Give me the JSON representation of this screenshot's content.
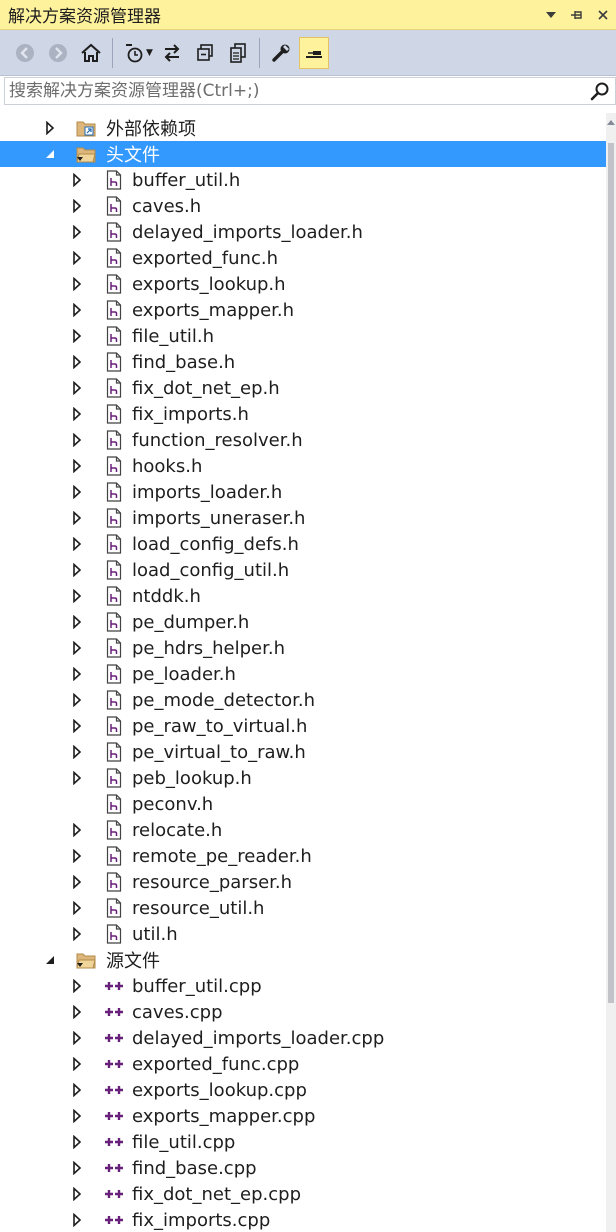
{
  "window": {
    "title": "解决方案资源管理器",
    "dropdown_icon": "chevron-down-icon",
    "pin_icon": "pin-icon",
    "close_icon": "close-icon"
  },
  "toolbar": {
    "items": [
      {
        "name": "back-button",
        "icon": "arrow-left-icon"
      },
      {
        "name": "forward-button",
        "icon": "arrow-right-icon"
      },
      {
        "name": "home-button",
        "icon": "home-icon"
      },
      {
        "name": "pending-changes-filter-button",
        "icon": "clock-filter-icon"
      },
      {
        "name": "sync-with-active-document-button",
        "icon": "sync-arrows-icon"
      },
      {
        "name": "collapse-all-button",
        "icon": "collapse-all-icon"
      },
      {
        "name": "show-all-files-button",
        "icon": "copy-files-icon"
      },
      {
        "name": "properties-button",
        "icon": "wrench-icon"
      },
      {
        "name": "preview-selected-items-button",
        "icon": "preview-icon"
      }
    ]
  },
  "search": {
    "placeholder": "搜索解决方案资源管理器(Ctrl+;)",
    "value": "",
    "icon": "search-icon"
  },
  "colors": {
    "title_bg": "#fff29d",
    "toolbar_bg": "#cfd6e5",
    "selection": "#3399ff",
    "cpp_icon": "#68217a"
  },
  "tree": {
    "external": {
      "label": "外部依赖项",
      "expanded": false
    },
    "headers": {
      "label": "头文件",
      "expanded": true,
      "selected": true,
      "files": [
        {
          "label": "buffer_util.h",
          "has_children": true
        },
        {
          "label": "caves.h",
          "has_children": true
        },
        {
          "label": "delayed_imports_loader.h",
          "has_children": true
        },
        {
          "label": "exported_func.h",
          "has_children": true
        },
        {
          "label": "exports_lookup.h",
          "has_children": true
        },
        {
          "label": "exports_mapper.h",
          "has_children": true
        },
        {
          "label": "file_util.h",
          "has_children": true
        },
        {
          "label": "find_base.h",
          "has_children": true
        },
        {
          "label": "fix_dot_net_ep.h",
          "has_children": true
        },
        {
          "label": "fix_imports.h",
          "has_children": true
        },
        {
          "label": "function_resolver.h",
          "has_children": true
        },
        {
          "label": "hooks.h",
          "has_children": true
        },
        {
          "label": "imports_loader.h",
          "has_children": true
        },
        {
          "label": "imports_uneraser.h",
          "has_children": true
        },
        {
          "label": "load_config_defs.h",
          "has_children": true
        },
        {
          "label": "load_config_util.h",
          "has_children": true
        },
        {
          "label": "ntddk.h",
          "has_children": true
        },
        {
          "label": "pe_dumper.h",
          "has_children": true
        },
        {
          "label": "pe_hdrs_helper.h",
          "has_children": true
        },
        {
          "label": "pe_loader.h",
          "has_children": true
        },
        {
          "label": "pe_mode_detector.h",
          "has_children": true
        },
        {
          "label": "pe_raw_to_virtual.h",
          "has_children": true
        },
        {
          "label": "pe_virtual_to_raw.h",
          "has_children": true
        },
        {
          "label": "peb_lookup.h",
          "has_children": true
        },
        {
          "label": "peconv.h",
          "has_children": false
        },
        {
          "label": "relocate.h",
          "has_children": true
        },
        {
          "label": "remote_pe_reader.h",
          "has_children": true
        },
        {
          "label": "resource_parser.h",
          "has_children": true
        },
        {
          "label": "resource_util.h",
          "has_children": true
        },
        {
          "label": "util.h",
          "has_children": true
        }
      ]
    },
    "sources": {
      "label": "源文件",
      "expanded": true,
      "files": [
        {
          "label": "buffer_util.cpp",
          "has_children": true
        },
        {
          "label": "caves.cpp",
          "has_children": true
        },
        {
          "label": "delayed_imports_loader.cpp",
          "has_children": true
        },
        {
          "label": "exported_func.cpp",
          "has_children": true
        },
        {
          "label": "exports_lookup.cpp",
          "has_children": true
        },
        {
          "label": "exports_mapper.cpp",
          "has_children": true
        },
        {
          "label": "file_util.cpp",
          "has_children": true
        },
        {
          "label": "find_base.cpp",
          "has_children": true
        },
        {
          "label": "fix_dot_net_ep.cpp",
          "has_children": true
        },
        {
          "label": "fix_imports.cpp",
          "has_children": true
        }
      ]
    }
  }
}
